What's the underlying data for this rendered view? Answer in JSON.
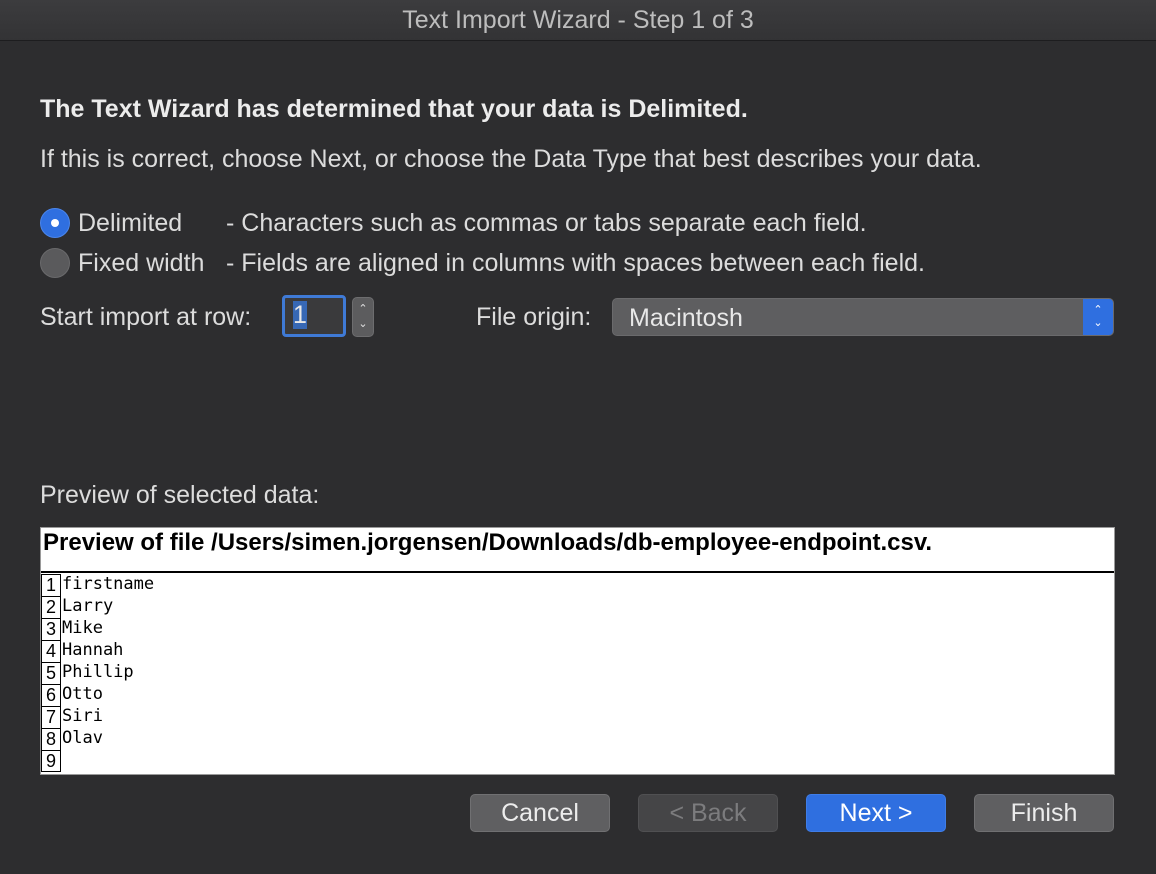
{
  "window": {
    "title": "Text Import Wizard - Step 1 of 3"
  },
  "intro": {
    "headline": "The Text Wizard has determined that your data is Delimited.",
    "subline": "If this is correct, choose Next, or choose the Data Type that best describes your data."
  },
  "data_type": {
    "selected": "Delimited",
    "options": [
      {
        "label": "Delimited",
        "description": "- Characters such as commas or tabs separate each field."
      },
      {
        "label": "Fixed width",
        "description": "- Fields are aligned in columns with spaces between each field."
      }
    ]
  },
  "start_row": {
    "label": "Start import at row:",
    "value": "1"
  },
  "file_origin": {
    "label": "File origin:",
    "value": "Macintosh"
  },
  "preview": {
    "label": "Preview of selected data:",
    "header": "Preview of file /Users/simen.jorgensen/Downloads/db-employee-endpoint.csv.",
    "rows": [
      {
        "num": "1",
        "text": "firstname"
      },
      {
        "num": "2",
        "text": "Larry"
      },
      {
        "num": "3",
        "text": "Mike"
      },
      {
        "num": "4",
        "text": "Hannah"
      },
      {
        "num": "5",
        "text": "Phillip"
      },
      {
        "num": "6",
        "text": "Otto"
      },
      {
        "num": "7",
        "text": "Siri"
      },
      {
        "num": "8",
        "text": "Olav"
      },
      {
        "num": "9",
        "text": ""
      }
    ]
  },
  "buttons": {
    "cancel": "Cancel",
    "back": "< Back",
    "next": "Next >",
    "finish": "Finish"
  },
  "colors": {
    "accent": "#2f6fe0",
    "background": "#2d2d2f"
  }
}
